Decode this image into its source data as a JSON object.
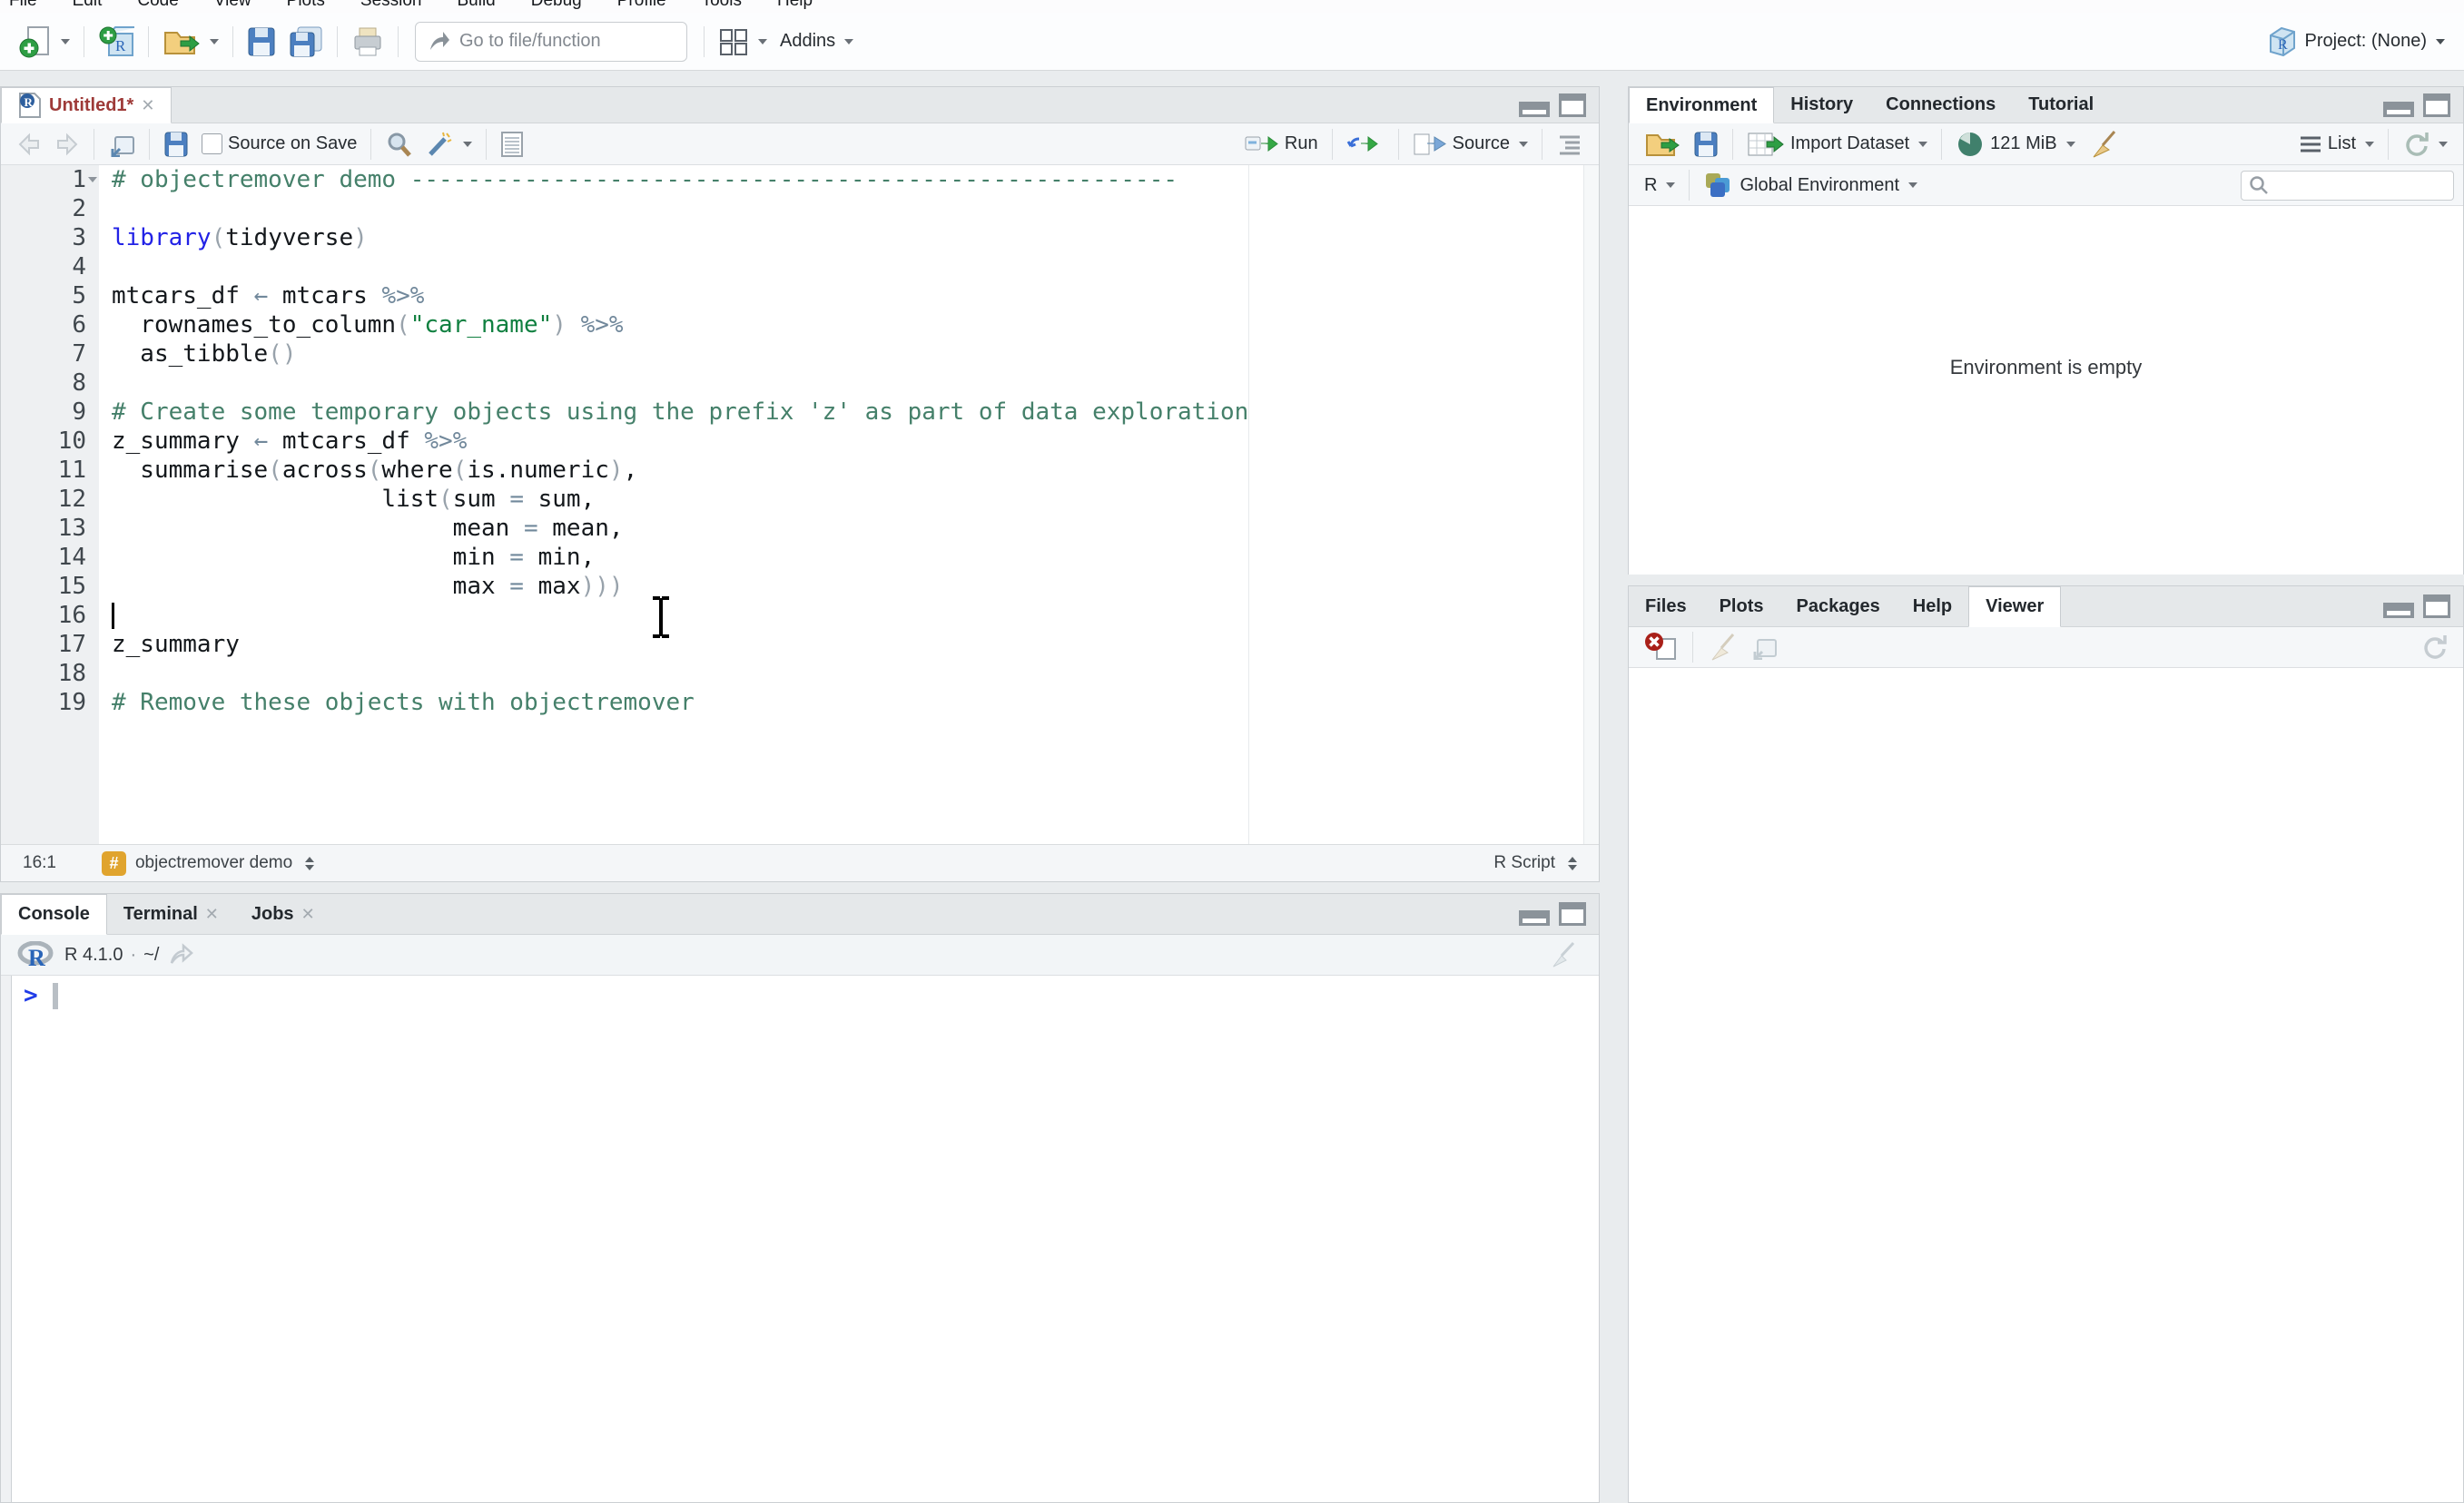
{
  "window": {
    "project_label": "Project: (None)"
  },
  "menu_bar": {
    "items": [
      "File",
      "Edit",
      "Code",
      "View",
      "Plots",
      "Session",
      "Build",
      "Debug",
      "Profile",
      "Tools",
      "Help"
    ]
  },
  "main_toolbar": {
    "goto_placeholder": "Go to file/function",
    "addins_label": "Addins"
  },
  "source_pane": {
    "tab_title": "Untitled1*",
    "toolbar": {
      "source_on_save": "Source on Save",
      "run": "Run",
      "source": "Source"
    },
    "status_bar": {
      "cursor_position": "16:1",
      "section": "objectremover demo",
      "file_type": "R Script"
    },
    "editor": {
      "cursor_line": 16,
      "lines": [
        {
          "n": 1,
          "fold": true,
          "tk": [
            [
              "comment",
              "# objectremover demo ------------------------------------------------------"
            ]
          ]
        },
        {
          "n": 2,
          "tk": []
        },
        {
          "n": 3,
          "tk": [
            [
              "keyword",
              "library"
            ],
            [
              "paren",
              "("
            ],
            [
              "plain",
              "tidyverse"
            ],
            [
              "paren",
              ")"
            ]
          ]
        },
        {
          "n": 4,
          "tk": []
        },
        {
          "n": 5,
          "tk": [
            [
              "plain",
              "mtcars_df "
            ],
            [
              "op",
              "←"
            ],
            [
              "plain",
              " mtcars "
            ],
            [
              "op",
              "%>%"
            ]
          ]
        },
        {
          "n": 6,
          "tk": [
            [
              "plain",
              "  rownames_to_column"
            ],
            [
              "paren",
              "("
            ],
            [
              "string",
              "\"car_name\""
            ],
            [
              "paren",
              ")"
            ],
            [
              "plain",
              " "
            ],
            [
              "op",
              "%>%"
            ]
          ]
        },
        {
          "n": 7,
          "tk": [
            [
              "plain",
              "  as_tibble"
            ],
            [
              "paren",
              "()"
            ]
          ]
        },
        {
          "n": 8,
          "tk": []
        },
        {
          "n": 9,
          "tk": [
            [
              "comment",
              "# Create some temporary objects using the prefix 'z' as part of data exploration"
            ]
          ]
        },
        {
          "n": 10,
          "tk": [
            [
              "plain",
              "z_summary "
            ],
            [
              "op",
              "←"
            ],
            [
              "plain",
              " mtcars_df "
            ],
            [
              "op",
              "%>%"
            ]
          ]
        },
        {
          "n": 11,
          "tk": [
            [
              "plain",
              "  summarise"
            ],
            [
              "paren",
              "("
            ],
            [
              "plain",
              "across"
            ],
            [
              "paren",
              "("
            ],
            [
              "plain",
              "where"
            ],
            [
              "paren",
              "("
            ],
            [
              "plain",
              "is.numeric"
            ],
            [
              "paren",
              ")"
            ],
            [
              "plain",
              ","
            ]
          ]
        },
        {
          "n": 12,
          "tk": [
            [
              "plain",
              "                   list"
            ],
            [
              "paren",
              "("
            ],
            [
              "plain",
              "sum "
            ],
            [
              "op",
              "="
            ],
            [
              "plain",
              " sum,"
            ]
          ]
        },
        {
          "n": 13,
          "tk": [
            [
              "plain",
              "                        mean "
            ],
            [
              "op",
              "="
            ],
            [
              "plain",
              " mean,"
            ]
          ]
        },
        {
          "n": 14,
          "tk": [
            [
              "plain",
              "                        min "
            ],
            [
              "op",
              "="
            ],
            [
              "plain",
              " min,"
            ]
          ]
        },
        {
          "n": 15,
          "tk": [
            [
              "plain",
              "                        max "
            ],
            [
              "op",
              "="
            ],
            [
              "plain",
              " max"
            ],
            [
              "paren",
              ")))"
            ]
          ]
        },
        {
          "n": 16,
          "tk": []
        },
        {
          "n": 17,
          "tk": [
            [
              "plain",
              "z_summary"
            ]
          ]
        },
        {
          "n": 18,
          "tk": []
        },
        {
          "n": 19,
          "tk": [
            [
              "comment",
              "# Remove these objects with objectremover"
            ]
          ]
        }
      ]
    }
  },
  "console_pane": {
    "tabs": [
      {
        "label": "Console",
        "active": true
      },
      {
        "label": "Terminal",
        "closable": true
      },
      {
        "label": "Jobs",
        "closable": true
      }
    ],
    "toolbar": {
      "r_version": "R 4.1.0",
      "dot": "·",
      "working_dir": "~/"
    },
    "prompt": ">"
  },
  "environment_pane": {
    "tabs": [
      {
        "label": "Environment",
        "active": true
      },
      {
        "label": "History"
      },
      {
        "label": "Connections"
      },
      {
        "label": "Tutorial"
      }
    ],
    "toolbar": {
      "import_dataset": "Import Dataset",
      "memory": "121 MiB",
      "list": "List"
    },
    "subtoolbar": {
      "language": "R",
      "scope": "Global Environment"
    },
    "empty_message": "Environment is empty"
  },
  "files_pane": {
    "tabs": [
      {
        "label": "Files"
      },
      {
        "label": "Plots"
      },
      {
        "label": "Packages"
      },
      {
        "label": "Help"
      },
      {
        "label": "Viewer",
        "active": true
      }
    ]
  },
  "colors": {
    "keyword_blue": "#2222e6",
    "comment_green": "#45806a",
    "string_green": "#108040",
    "operator_slate": "#71889b",
    "unsaved_red": "#9e3a38",
    "section_chip_orange": "#e0a42e",
    "prompt_blue": "#1f3be8"
  }
}
